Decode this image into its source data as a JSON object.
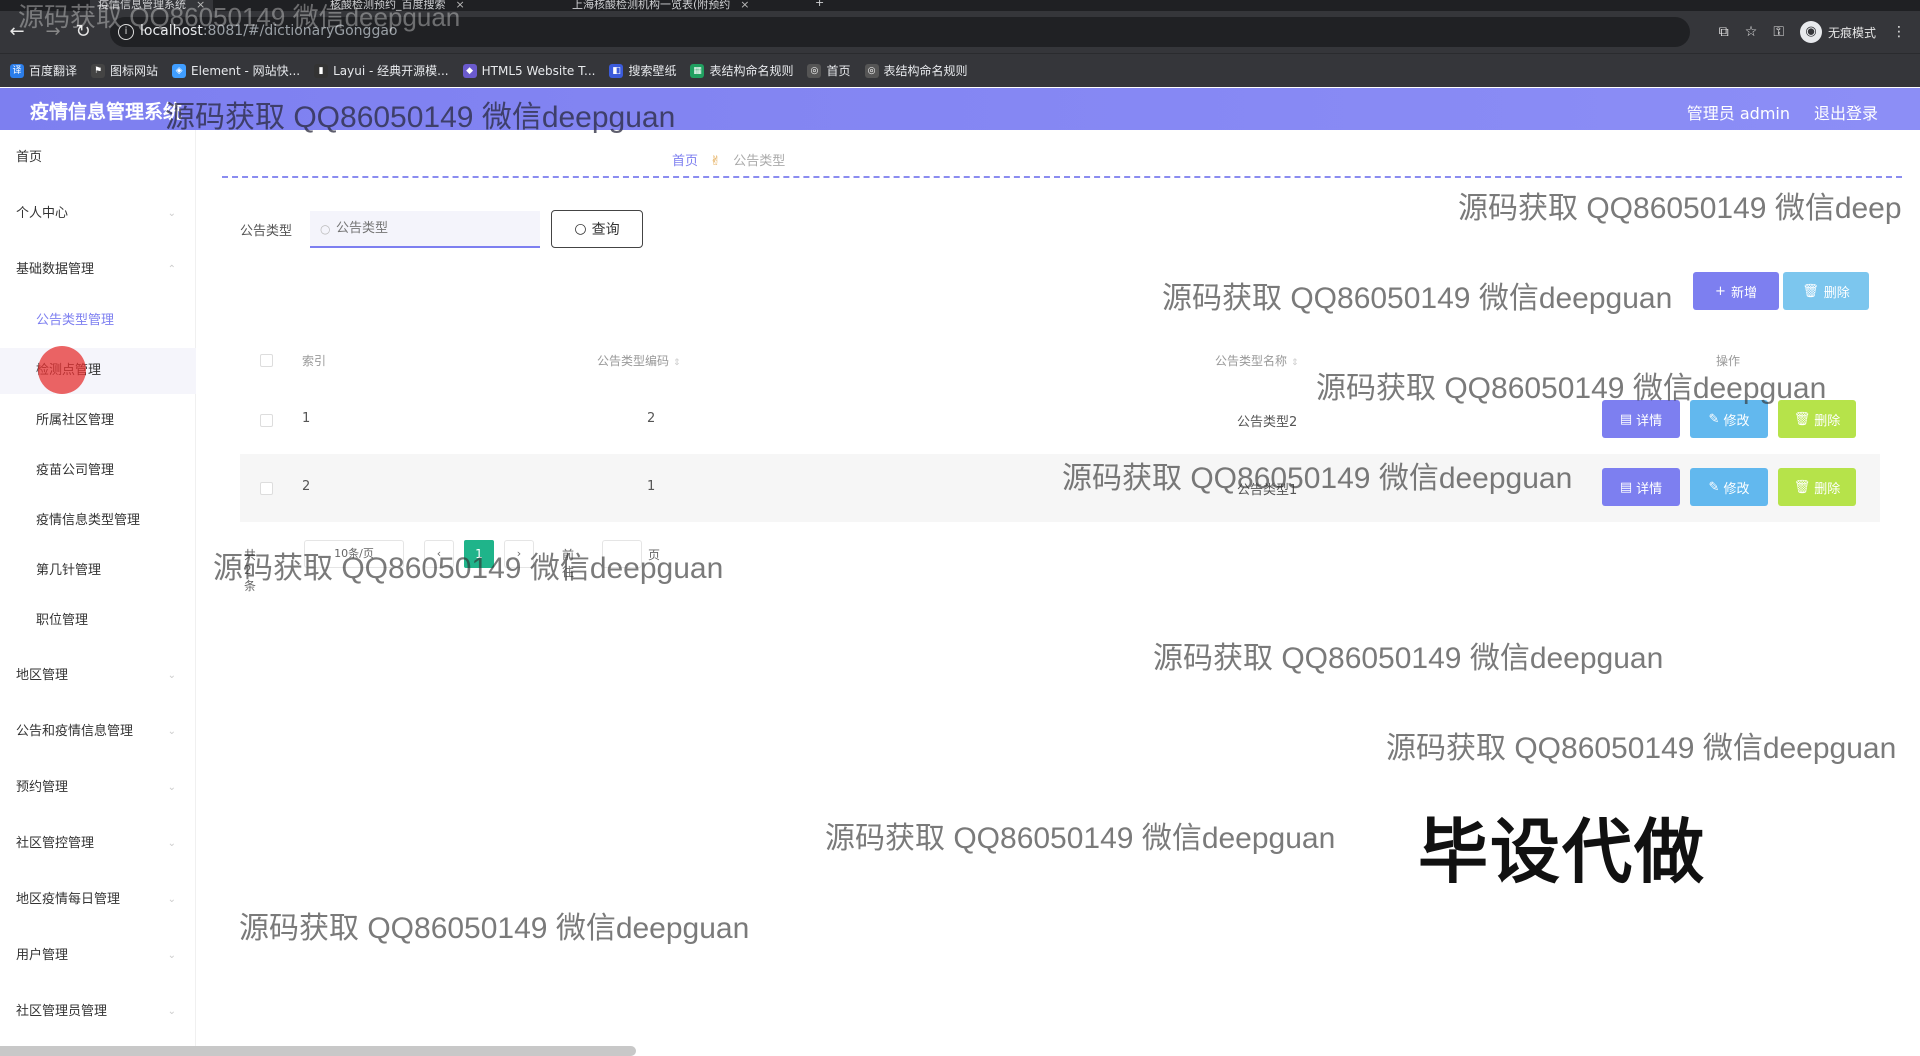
{
  "browser": {
    "tabs": [
      {
        "label": "疫情信息管理系统",
        "active": true
      },
      {
        "label": "核酸检测预约_百度搜索",
        "active": false
      },
      {
        "label": "上海核酸检测机构一览表(附预约",
        "active": false
      }
    ],
    "url_host": "localhost",
    "url_rest": ":8081/#/dictionaryGonggao",
    "incognito_label": "无痕模式",
    "bookmarks": [
      {
        "label": "百度翻译",
        "color": "#2b7de9"
      },
      {
        "label": "图标网站",
        "color": "#444444"
      },
      {
        "label": "Element - 网站快...",
        "color": "#409eff"
      },
      {
        "label": "Layui - 经典开源模...",
        "color": "#333333"
      },
      {
        "label": "HTML5 Website T...",
        "color": "#6a5acd"
      },
      {
        "label": "搜索壁纸",
        "color": "#3b5bdb"
      },
      {
        "label": "表结构命名规则",
        "color": "#20a060"
      },
      {
        "label": "首页",
        "color": "#555555"
      },
      {
        "label": "表结构命名规则",
        "color": "#555555"
      }
    ]
  },
  "header": {
    "title": "疫情信息管理系统",
    "user": "管理员 admin",
    "logout": "退出登录",
    "accent": "#7d7ff0"
  },
  "sidebar": {
    "items": [
      {
        "label": "首页"
      },
      {
        "label": "个人中心"
      },
      {
        "label": "基础数据管理"
      },
      {
        "label": "地区管理"
      },
      {
        "label": "公告和疫情信息管理"
      },
      {
        "label": "预约管理"
      },
      {
        "label": "社区管控管理"
      },
      {
        "label": "地区疫情每日管理"
      },
      {
        "label": "用户管理"
      },
      {
        "label": "社区管理员管理"
      }
    ],
    "subitems": [
      {
        "label": "公告类型管理"
      },
      {
        "label": "检测点管理"
      },
      {
        "label": "所属社区管理"
      },
      {
        "label": "疫苗公司管理"
      },
      {
        "label": "疫情信息类型管理"
      },
      {
        "label": "第几针管理"
      },
      {
        "label": "职位管理"
      }
    ]
  },
  "breadcrumb": {
    "home": "首页",
    "current": "公告类型"
  },
  "filter": {
    "label": "公告类型",
    "placeholder": "公告类型",
    "query_label": "查询"
  },
  "actions": {
    "add": "新增",
    "delete": "删除"
  },
  "table": {
    "headers": {
      "index": "索引",
      "code": "公告类型编码",
      "name": "公告类型名称",
      "ops": "操作"
    },
    "rows": [
      {
        "index": "1",
        "code": "2",
        "name": "公告类型2"
      },
      {
        "index": "2",
        "code": "1",
        "name": "公告类型1"
      }
    ],
    "op_labels": {
      "detail": "详情",
      "edit": "修改",
      "delete": "删除"
    }
  },
  "pager": {
    "total": "共 2 条",
    "page_size": "10条/页",
    "current": "1",
    "goto_prefix": "前往",
    "goto_suffix": "页"
  },
  "watermark": "源码获取 QQ86050149 微信deepguan",
  "watermark_cut": "源码获取 QQ86050149 微信deep",
  "promo": "毕设代做"
}
